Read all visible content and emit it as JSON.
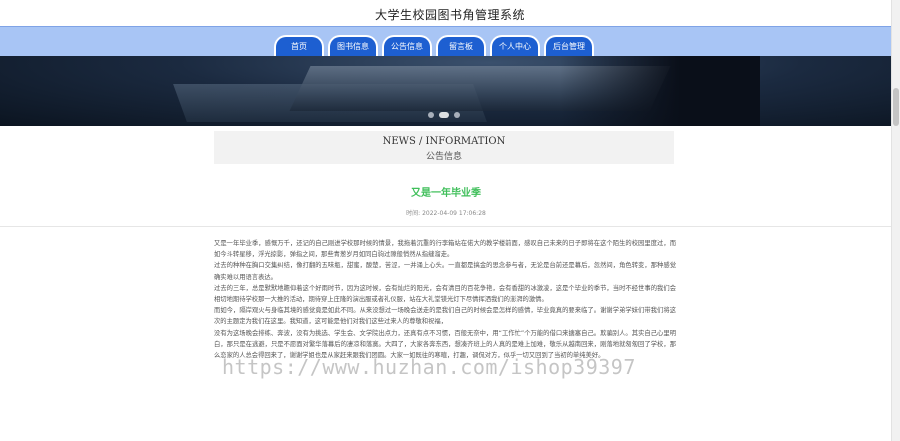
{
  "header": {
    "site_title": "大学生校园图书角管理系统"
  },
  "nav": {
    "items": [
      {
        "label": "首页"
      },
      {
        "label": "图书信息"
      },
      {
        "label": "公告信息"
      },
      {
        "label": "留言板"
      },
      {
        "label": "个人中心"
      },
      {
        "label": "后台管理"
      }
    ]
  },
  "section": {
    "title_en": "NEWS / INFORMATION",
    "title_cn": "公告信息"
  },
  "article": {
    "title": "又是一年毕业季",
    "time": "时间: 2022-04-09 17:06:28",
    "paragraphs": [
      "又是一年毕业季，感慨万千，还记的自己刚进学校那时候的情景，我拖着沉重的行李箱站在偌大的教学楼前面，感叹自己未来的日子即将在这个陌生的校园里度过，而如今斗转星移，浮光掠影，弹指之间，那些青葱岁月如同白驹过隙般悄然从指缝溜走。",
      "过去的种种在胸口交集纠结，像打翻的五味瓶，甜蜜，酸楚，苦涩，一并涌上心头。一直都是搞金的思念参与者，无论是台前还是幕后，忽然间，角色转变，那种感觉确实难以用语言表达。",
      "过去的三年，总是默默地瞻仰着这个好雨时节，因为这时候，会有灿烂的阳光，会有清目的百花争艳，会有香甜的冰激凌，这是个毕业的季节，当时不经世事的我们会相切地期待学校那一大推的活动，期待穿上庄隆的演出服或者礼仪服，站在大礼堂镁光灯下尽情挥洒我们的澎湃的激情。",
      "而如今，隔岸观火与身临其境的感觉竟是如此不同。从来没想过一场晚会送走的是我们自己的时候会是怎样的感情，毕业竟真的要来临了。谢谢学弟学妹们带我们将这次的主题定为我们在这里。我知道，这可能是他们对我们这些过来人的尊敬和祝福，",
      "没有为这场晚会排练、奔波，没有为挑选、学生会、文学院出点力，还真有点不习惯，百般无奈中，用“工作忙”个万能的借口来搪塞自己。欺骗别人。其实自己心里明白，那只是在逃避，只是不愿面对繁华落幕后的凄凉和落寞。大四了，大家各奔东西，想凑齐班上的人真的是难上加难，敬乐从越南回来，刚落地就匆匆回了学校，那么恋家的人总会得回来了，谢谢学姐也是从家赶来跟我们团圆。大家一如既往的寒暄，打趣，调侃对方，似乎一切又回到了当初的单纯美好。"
    ]
  },
  "watermark": {
    "text": "https://www.huzhan.com/ishop39397"
  }
}
